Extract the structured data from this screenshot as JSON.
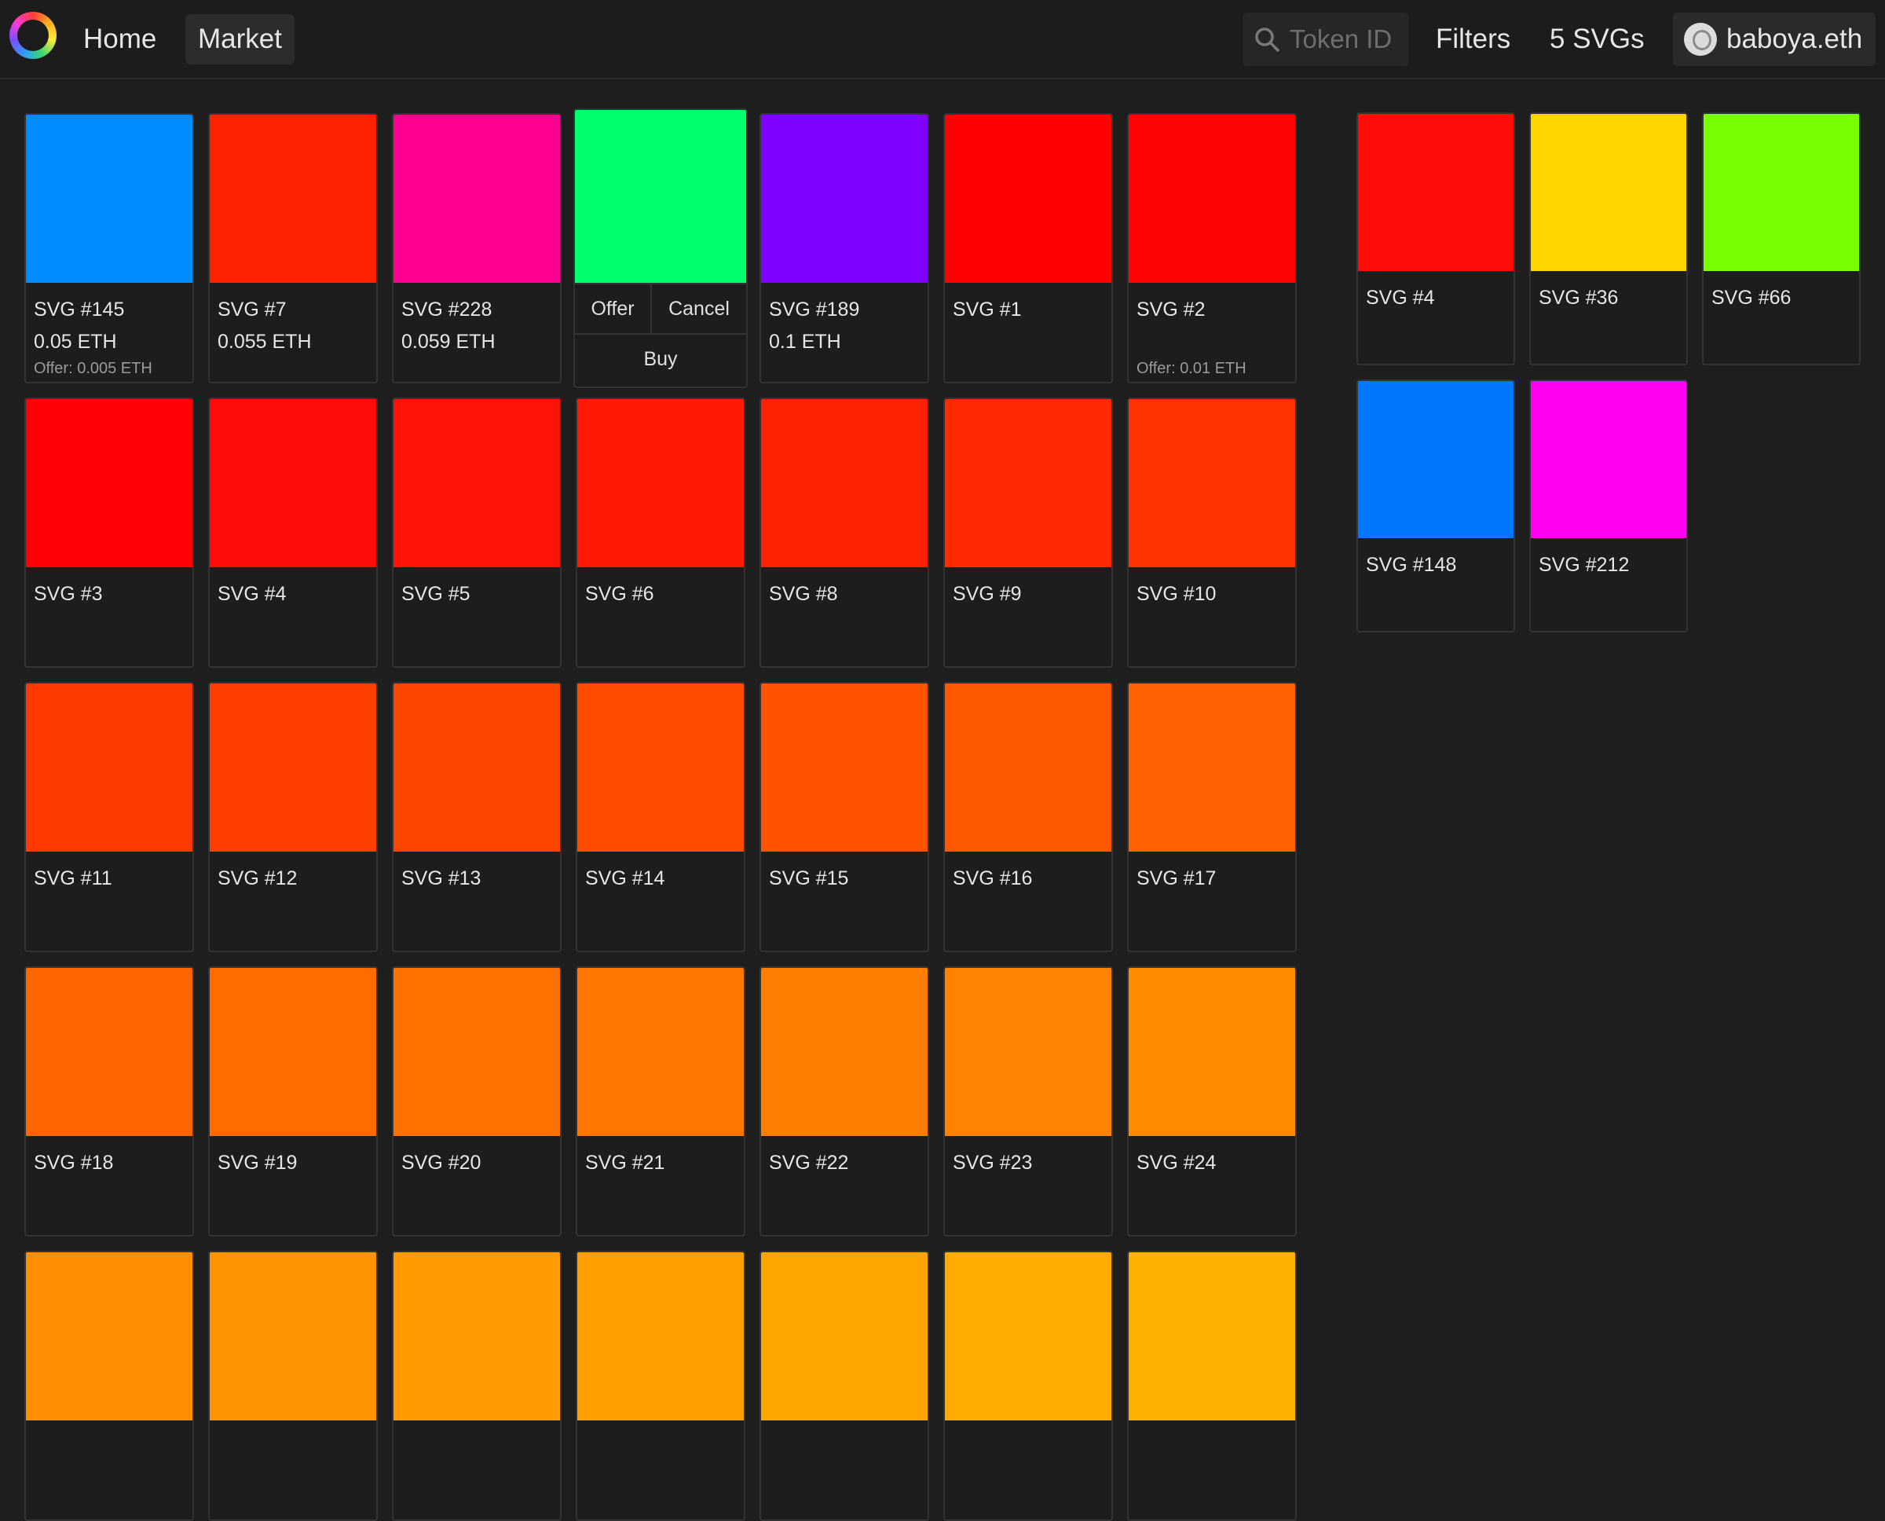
{
  "nav": {
    "home": "Home",
    "market": "Market"
  },
  "search": {
    "placeholder": "Token ID"
  },
  "header": {
    "filters": "Filters",
    "count": "5 SVGs",
    "account": "baboya.eth"
  },
  "icons": {
    "search": "search-icon",
    "logo": "app-logo",
    "avatar": "avatar-image"
  },
  "market": {
    "cards": [
      {
        "label": "SVG #145",
        "color": "#008cff",
        "price": "0.05 ETH",
        "offer": "Offer: 0.005 ETH"
      },
      {
        "label": "SVG #7",
        "color": "#ff2200",
        "price": "0.055 ETH",
        "offer": ""
      },
      {
        "label": "SVG #228",
        "color": "#ff0090",
        "price": "0.059 ETH",
        "offer": ""
      },
      {
        "label": "",
        "color": "#00ff6e",
        "price": "",
        "offer": "",
        "actions": {
          "offer": "Offer",
          "cancel": "Cancel",
          "buy": "Buy"
        }
      },
      {
        "label": "SVG #189",
        "color": "#8000ff",
        "price": "0.1 ETH",
        "offer": ""
      },
      {
        "label": "SVG #1",
        "color": "#ff0000",
        "price": "",
        "offer": ""
      },
      {
        "label": "SVG #2",
        "color": "#ff0404",
        "price": "",
        "offer": "Offer: 0.01 ETH"
      },
      {
        "label": "SVG #3",
        "color": "#ff0006",
        "price": "",
        "offer": ""
      },
      {
        "label": "SVG #4",
        "color": "#ff0c08",
        "price": "",
        "offer": ""
      },
      {
        "label": "SVG #5",
        "color": "#ff1309",
        "price": "",
        "offer": ""
      },
      {
        "label": "SVG #6",
        "color": "#ff1b05",
        "price": "",
        "offer": ""
      },
      {
        "label": "SVG #8",
        "color": "#ff2304",
        "price": "",
        "offer": ""
      },
      {
        "label": "SVG #9",
        "color": "#ff2a02",
        "price": "",
        "offer": ""
      },
      {
        "label": "SVG #10",
        "color": "#ff3301",
        "price": "",
        "offer": ""
      },
      {
        "label": "SVG #11",
        "color": "#ff3a00",
        "price": "",
        "offer": ""
      },
      {
        "label": "SVG #12",
        "color": "#ff3f00",
        "price": "",
        "offer": ""
      },
      {
        "label": "SVG #13",
        "color": "#ff4600",
        "price": "",
        "offer": ""
      },
      {
        "label": "SVG #14",
        "color": "#ff4c00",
        "price": "",
        "offer": ""
      },
      {
        "label": "SVG #15",
        "color": "#ff5300",
        "price": "",
        "offer": ""
      },
      {
        "label": "SVG #16",
        "color": "#ff5900",
        "price": "",
        "offer": ""
      },
      {
        "label": "SVG #17",
        "color": "#ff6000",
        "price": "",
        "offer": ""
      },
      {
        "label": "SVG #18",
        "color": "#ff6600",
        "price": "",
        "offer": ""
      },
      {
        "label": "SVG #19",
        "color": "#ff6b00",
        "price": "",
        "offer": ""
      },
      {
        "label": "SVG #20",
        "color": "#ff7100",
        "price": "",
        "offer": ""
      },
      {
        "label": "SVG #21",
        "color": "#ff7700",
        "price": "",
        "offer": ""
      },
      {
        "label": "SVG #22",
        "color": "#ff7d00",
        "price": "",
        "offer": ""
      },
      {
        "label": "SVG #23",
        "color": "#ff8300",
        "price": "",
        "offer": ""
      },
      {
        "label": "SVG #24",
        "color": "#ff8a00",
        "price": "",
        "offer": ""
      },
      {
        "label": "",
        "color": "#ff8f00",
        "price": "",
        "offer": ""
      },
      {
        "label": "",
        "color": "#ff9400",
        "price": "",
        "offer": ""
      },
      {
        "label": "",
        "color": "#ff9a00",
        "price": "",
        "offer": ""
      },
      {
        "label": "",
        "color": "#ffa000",
        "price": "",
        "offer": ""
      },
      {
        "label": "",
        "color": "#ffa500",
        "price": "",
        "offer": ""
      },
      {
        "label": "",
        "color": "#ffab00",
        "price": "",
        "offer": ""
      },
      {
        "label": "",
        "color": "#ffb000",
        "price": "",
        "offer": ""
      }
    ]
  },
  "owned": {
    "cards": [
      {
        "label": "SVG #4",
        "color": "#ff0c08"
      },
      {
        "label": "SVG #36",
        "color": "#ffd600"
      },
      {
        "label": "SVG #66",
        "color": "#78ff00"
      },
      {
        "label": "SVG #148",
        "color": "#0077ff"
      },
      {
        "label": "SVG #212",
        "color": "#ff00f0"
      }
    ]
  }
}
